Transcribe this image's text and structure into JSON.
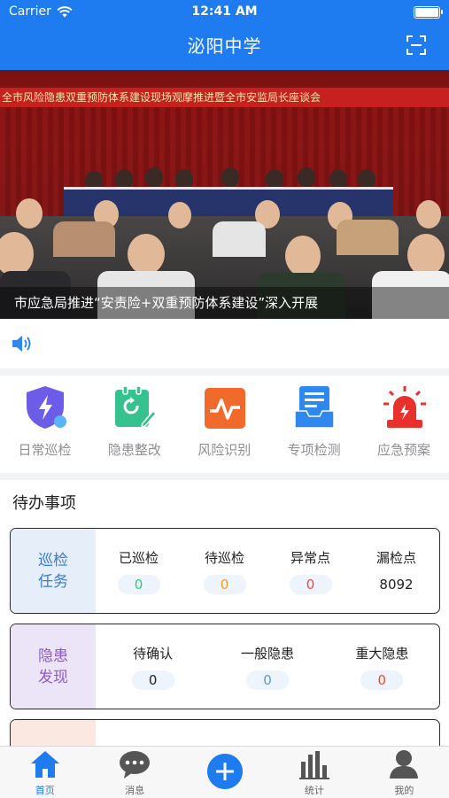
{
  "status_bar": {
    "carrier": "Carrier",
    "time": "12:41 AM"
  },
  "header": {
    "title": "泌阳中学",
    "scan_icon": "scan-icon"
  },
  "banner": {
    "slogan": "全市风险隐患双重预防体系建设现场观摩推进暨全市安监局长座谈会",
    "caption": "市应急局推进“安责险+双重预防体系建设”深入开展"
  },
  "notice": {
    "icon": "speaker-icon"
  },
  "menu": [
    {
      "label": "日常巡检",
      "icon": "shield-bolt-icon",
      "color": "#6c5ce7"
    },
    {
      "label": "隐患整改",
      "icon": "clipboard-edit-icon",
      "color": "#35c28f"
    },
    {
      "label": "风险识别",
      "icon": "pulse-chart-icon",
      "color": "#f06a2b"
    },
    {
      "label": "专项检测",
      "icon": "document-tray-icon",
      "color": "#2f88f0"
    },
    {
      "label": "应急预案",
      "icon": "alarm-siren-icon",
      "color": "#e8302c"
    }
  ],
  "todo": {
    "title": "待办事项",
    "cards": [
      {
        "name": "巡检任务",
        "line1": "巡检",
        "line2": "任务",
        "side_bg": "#e5eef9",
        "side_color": "#3a7bd5",
        "items": [
          {
            "label": "已巡检",
            "value": "0",
            "color": "#2ecc71"
          },
          {
            "label": "待巡检",
            "value": "0",
            "color": "#f39c12"
          },
          {
            "label": "异常点",
            "value": "0",
            "color": "#e74c3c"
          },
          {
            "label": "漏检点",
            "value": "8092",
            "color": "#222222"
          }
        ]
      },
      {
        "name": "隐患发现",
        "line1": "隐患",
        "line2": "发现",
        "side_bg": "#ece4f7",
        "side_color": "#8e5ccf",
        "items": [
          {
            "label": "待确认",
            "value": "0",
            "color": "#222222"
          },
          {
            "label": "一般隐患",
            "value": "0",
            "color": "#5b9bd5"
          },
          {
            "label": "重大隐患",
            "value": "0",
            "color": "#e74c3c"
          }
        ]
      }
    ]
  },
  "tabbar": [
    {
      "label": "首页",
      "icon": "home-icon"
    },
    {
      "label": "消息",
      "icon": "chat-bubble-icon"
    },
    {
      "label": "",
      "icon": "plus-icon"
    },
    {
      "label": "统计",
      "icon": "bar-chart-icon"
    },
    {
      "label": "我的",
      "icon": "user-icon"
    }
  ],
  "colors": {
    "primary": "#1e7bf0",
    "background": "#f2f3f5"
  }
}
